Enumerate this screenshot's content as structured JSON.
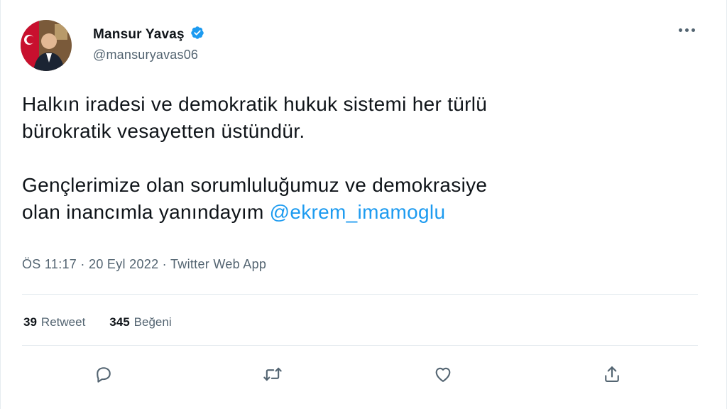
{
  "user": {
    "name": "Mansur Yavaş",
    "handle": "@mansuryavas06"
  },
  "tweet": {
    "line1": "Halkın iradesi ve demokratik hukuk sistemi her türlü\nbürokratik vesayetten üstündür.",
    "line2": "Gençlerimize olan sorumluluğumuz ve demokrasiye\nolan inancımla yanındayım ",
    "mention": "@ekrem_imamoglu"
  },
  "meta": {
    "time_date": "ÖS 11:17 · 20 Eyl 2022 · ",
    "source": "Twitter Web App"
  },
  "stats": {
    "retweets_count": "39",
    "retweets_label": "Retweet",
    "likes_count": "345",
    "likes_label": "Beğeni"
  },
  "colors": {
    "accent": "#1d9bf0",
    "secondary_text": "#536471",
    "divider": "#e6ecf0"
  },
  "icons": [
    "verified-badge-icon",
    "more-icon",
    "reply-icon",
    "retweet-icon",
    "like-icon",
    "share-icon"
  ]
}
